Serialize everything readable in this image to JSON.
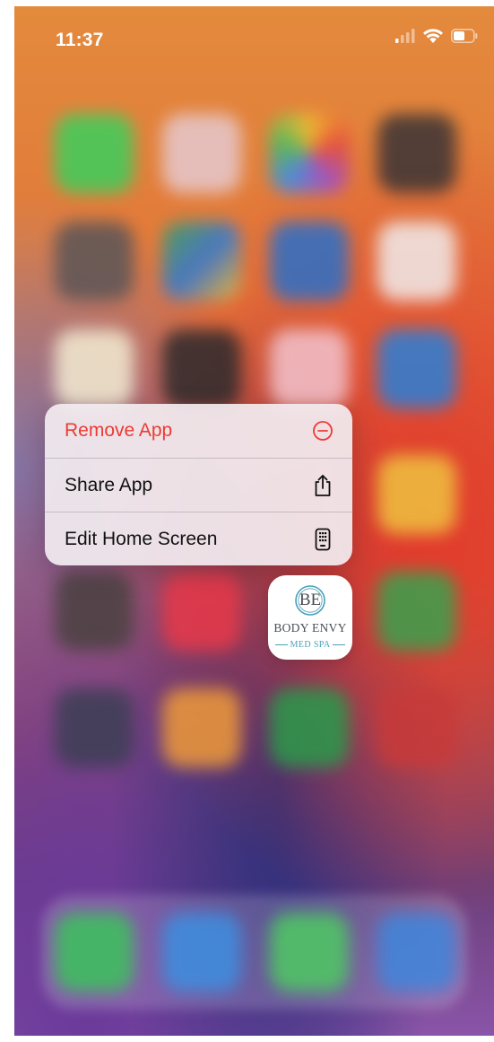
{
  "status_bar": {
    "time": "11:37",
    "icons": [
      "cellular-signal-icon",
      "wifi-icon",
      "battery-icon"
    ]
  },
  "context_menu": {
    "items": [
      {
        "label": "Remove App",
        "icon": "minus-circle-icon",
        "destructive": true
      },
      {
        "label": "Share App",
        "icon": "share-icon",
        "destructive": false
      },
      {
        "label": "Edit Home Screen",
        "icon": "phone-grid-icon",
        "destructive": false
      }
    ]
  },
  "app_icon": {
    "monogram": "BE",
    "line1": "BODY ENVY",
    "line2": "MED SPA"
  },
  "colors": {
    "destructive": "#eb3b34",
    "menu_background": "#f2ecf0",
    "logo_accent": "#4aa0b8"
  }
}
